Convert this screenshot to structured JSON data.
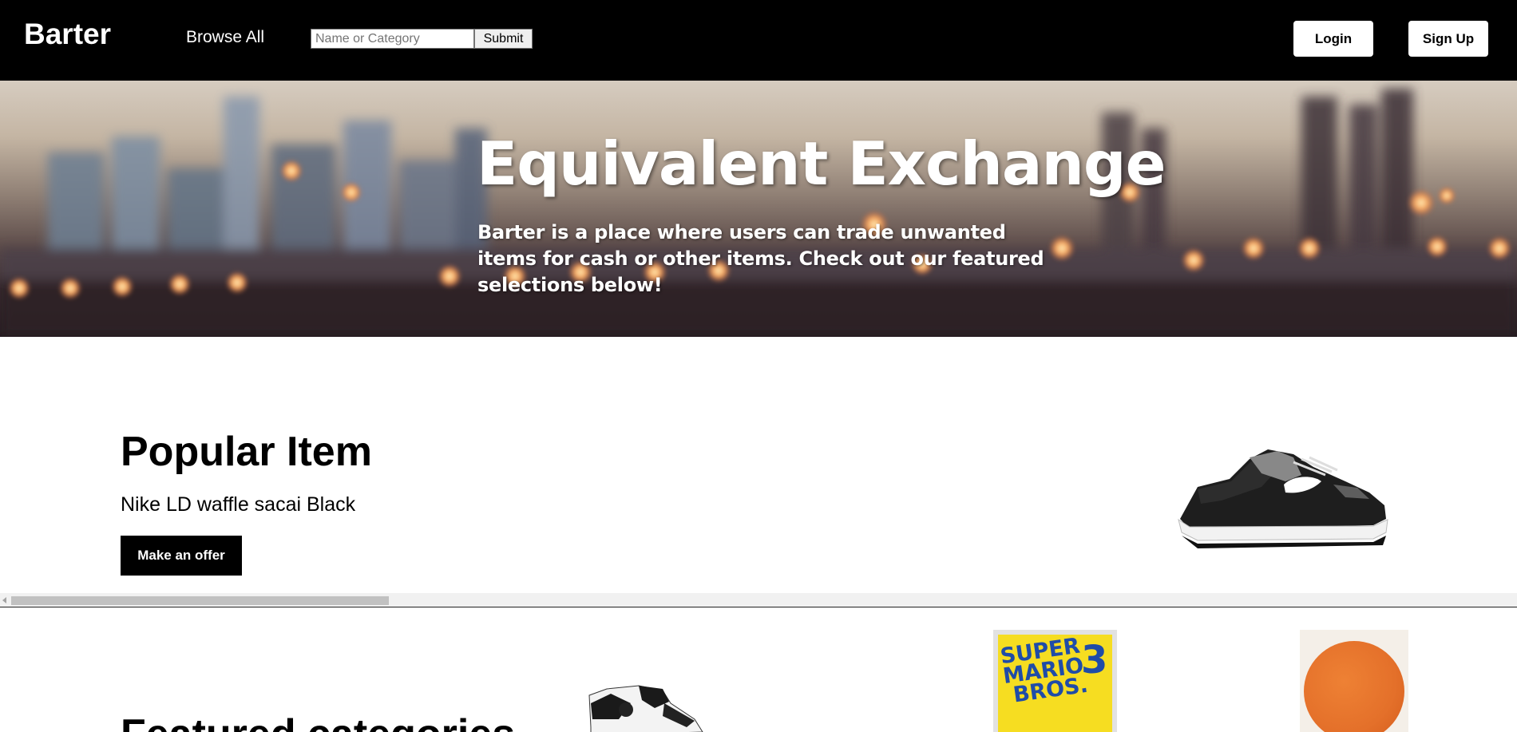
{
  "nav": {
    "brand": "Barter",
    "browse_label": "Browse All",
    "search_placeholder": "Name or Category",
    "submit_label": "Submit",
    "login_label": "Login",
    "signup_label": "Sign Up"
  },
  "hero": {
    "title": "Equivalent Exchange",
    "description": "Barter is a place where users can trade unwanted items for cash or other items. Check out our featured selections below!"
  },
  "popular": {
    "heading": "Popular Item",
    "item_name": "Nike LD waffle sacai Black",
    "offer_label": "Make an offer"
  },
  "featured": {
    "heading": "Featured categories",
    "poster_title": "SUPER\nMARIO\n BROS.",
    "poster_number": "3"
  },
  "colors": {
    "navbar": "#000000",
    "button_dark": "#000000",
    "button_light": "#ffffff",
    "poster_yellow": "#f6dd21",
    "poster_blue": "#1f4ca8",
    "album_orange": "#e4702a"
  },
  "icons": {
    "scroll_left": "chevron-left-icon"
  }
}
